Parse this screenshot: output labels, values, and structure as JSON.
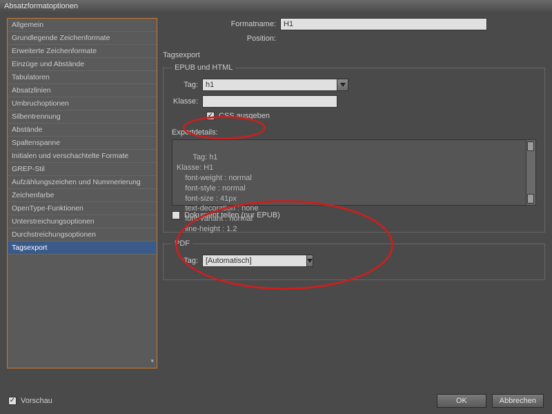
{
  "window": {
    "title": "Absatzformatoptionen"
  },
  "sidebar": {
    "items": [
      "Allgemein",
      "Grundlegende Zeichenformate",
      "Erweiterte Zeichenformate",
      "Einzüge und Abstände",
      "Tabulatoren",
      "Absatzlinien",
      "Umbruchoptionen",
      "Silbentrennung",
      "Abstände",
      "Spaltenspanne",
      "Initialen und verschachtelte Formate",
      "GREP-Stil",
      "Aufzählungszeichen und Nummerierung",
      "Zeichenfarbe",
      "OpenType-Funktionen",
      "Unterstreichungsoptionen",
      "Durchstreichungsoptionen",
      "Tagsexport"
    ],
    "selected_index": 17
  },
  "header": {
    "formatname_label": "Formatname:",
    "formatname_value": "H1",
    "position_label": "Position:"
  },
  "main": {
    "section_title": "Tagsexport",
    "epub_html": {
      "legend": "EPUB und HTML",
      "tag_label": "Tag:",
      "tag_value": "h1",
      "class_label": "Klasse:",
      "class_value": "",
      "css_checkbox_label": "CSS ausgeben",
      "css_checked": true,
      "export_details_label": "Exportdetails:",
      "export_details_text": "Tag: h1\nKlasse: H1\n    font-weight : normal\n    font-style : normal\n    font-size : 41px\n    text-decoration : none\n    font-variant : normal\n    line-height : 1.2",
      "split_doc_label": "Dokument teilen (nur EPUB)",
      "split_doc_checked": false
    },
    "pdf": {
      "legend": "PDF",
      "tag_label": "Tag:",
      "tag_value": "[Automatisch]"
    }
  },
  "footer": {
    "preview_label": "Vorschau",
    "preview_checked": true,
    "ok_label": "OK",
    "cancel_label": "Abbrechen"
  }
}
